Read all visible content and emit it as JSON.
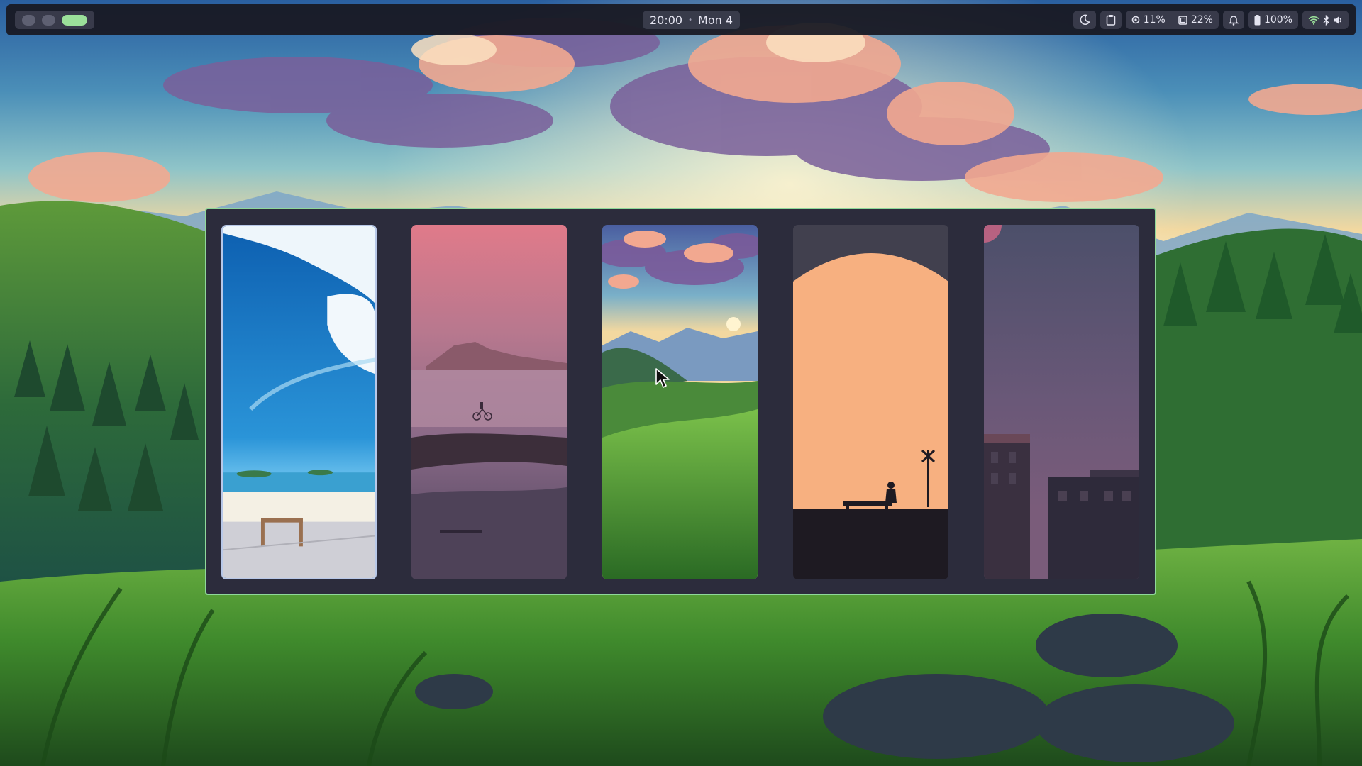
{
  "topbar": {
    "workspaces": [
      {
        "name": "workspace-1",
        "active": false
      },
      {
        "name": "workspace-2",
        "active": false
      },
      {
        "name": "workspace-3",
        "active": true
      }
    ],
    "time": "20:00",
    "separator": "•",
    "date": "Mon 4",
    "tray": {
      "night_mode_icon": "moon-icon",
      "clipboard_icon": "clipboard-icon",
      "cpu_icon": "cpu-icon",
      "cpu_value": "11%",
      "memory_icon": "memory-icon",
      "memory_value": "22%",
      "notifications_icon": "bell-icon",
      "battery_icon": "battery-icon",
      "battery_value": "100%",
      "wifi_icon": "wifi-icon",
      "bluetooth_icon": "bluetooth-icon",
      "volume_icon": "volume-icon"
    }
  },
  "picker": {
    "accent_color": "#8fd89a",
    "wallpapers": [
      {
        "name": "beach-sky-clouds",
        "selected": true
      },
      {
        "name": "pink-lake-bicycle",
        "selected": false
      },
      {
        "name": "mountain-valley-sunset",
        "selected": false
      },
      {
        "name": "orange-sun-bench-silhouette",
        "selected": false
      },
      {
        "name": "purple-dusk-buildings",
        "selected": false
      }
    ]
  },
  "colors": {
    "bar_bg": "#181822",
    "pill_bg": "#3c3e4e",
    "active_workspace": "#9be09a",
    "picker_bg": "#2c2c3c"
  }
}
